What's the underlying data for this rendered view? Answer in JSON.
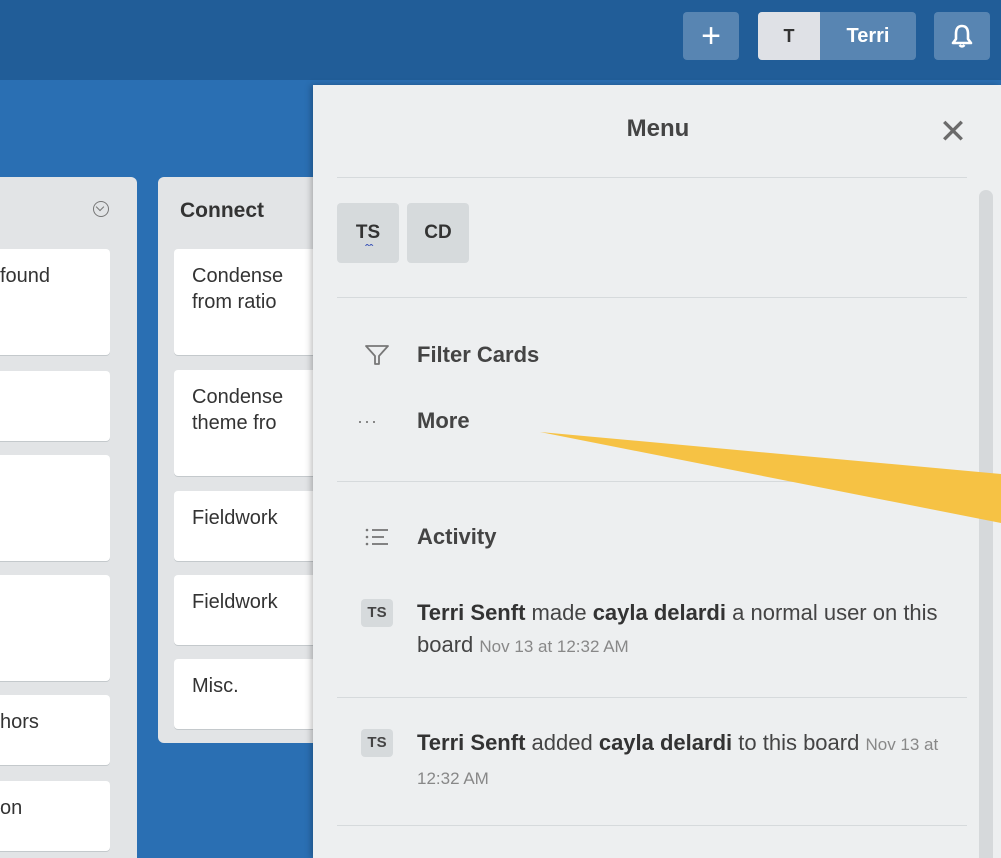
{
  "header": {
    "add_label": "+",
    "user_initial": "T",
    "user_name": "Terri"
  },
  "lists": [
    {
      "title": "",
      "cards": [
        "found",
        "",
        "",
        "",
        "hors",
        "on"
      ]
    },
    {
      "title": "Connect",
      "cards": [
        "Condense from ratio",
        "Condense theme fro",
        "Fieldwork",
        "Fieldwork",
        "Misc."
      ]
    }
  ],
  "menu": {
    "title": "Menu",
    "members": [
      "TS",
      "CD"
    ],
    "items": [
      {
        "icon": "filter-icon",
        "label": "Filter Cards"
      },
      {
        "icon": "more-icon",
        "label": "More"
      },
      {
        "icon": "activity-icon",
        "label": "Activity"
      }
    ],
    "activities": [
      {
        "avatar": "TS",
        "actor": "Terri Senft",
        "verb": "made",
        "target": "cayla delardi",
        "rest": "a normal user on this board",
        "time": "Nov 13 at 12:32 AM"
      },
      {
        "avatar": "TS",
        "actor": "Terri Senft",
        "verb": "added",
        "target": "cayla delardi",
        "rest": "to this board",
        "time": "Nov 13 at 12:32 AM"
      }
    ]
  },
  "colors": {
    "header": "#215d98",
    "board": "#2a6fb3",
    "menu_bg": "#edeff0",
    "annotation_arrow": "#f6c244"
  }
}
